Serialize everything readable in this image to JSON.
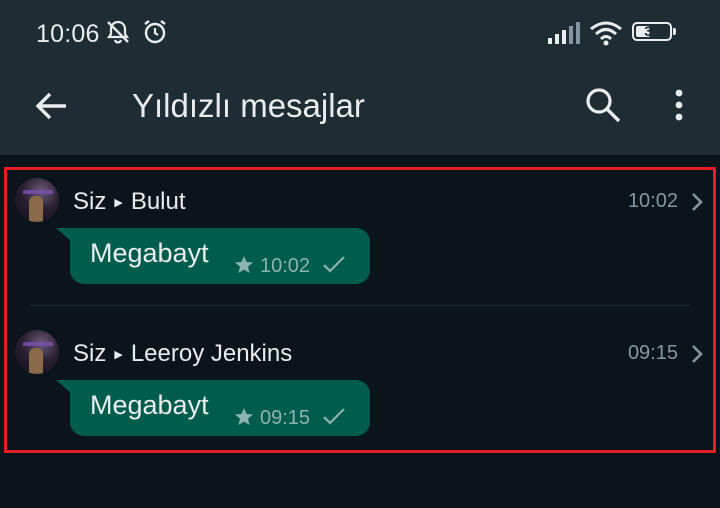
{
  "status_bar": {
    "time": "10:06",
    "battery": "38",
    "battery_level": 0.38,
    "icons": [
      "notifications-muted-icon",
      "alarm-icon",
      "signal-icon",
      "wifi-icon",
      "battery-icon"
    ]
  },
  "app_bar": {
    "title": "Yıldızlı mesajlar",
    "icons": [
      "back-arrow-icon",
      "search-icon",
      "more-vert-icon"
    ]
  },
  "colors": {
    "app_bar_bg": "#1f2c34",
    "background": "#0b141a",
    "outgoing_bubble": "#005c4b",
    "highlight_border": "#e51e25",
    "secondary_text": "#8696a0"
  },
  "messages": [
    {
      "sender": "Siz",
      "recipient": "Bulut",
      "time": "10:02",
      "text": "Megabayt",
      "bubble_time": "10:02"
    },
    {
      "sender": "Siz",
      "recipient": "Leeroy Jenkins",
      "time": "09:15",
      "text": "Megabayt",
      "bubble_time": "09:15"
    }
  ]
}
